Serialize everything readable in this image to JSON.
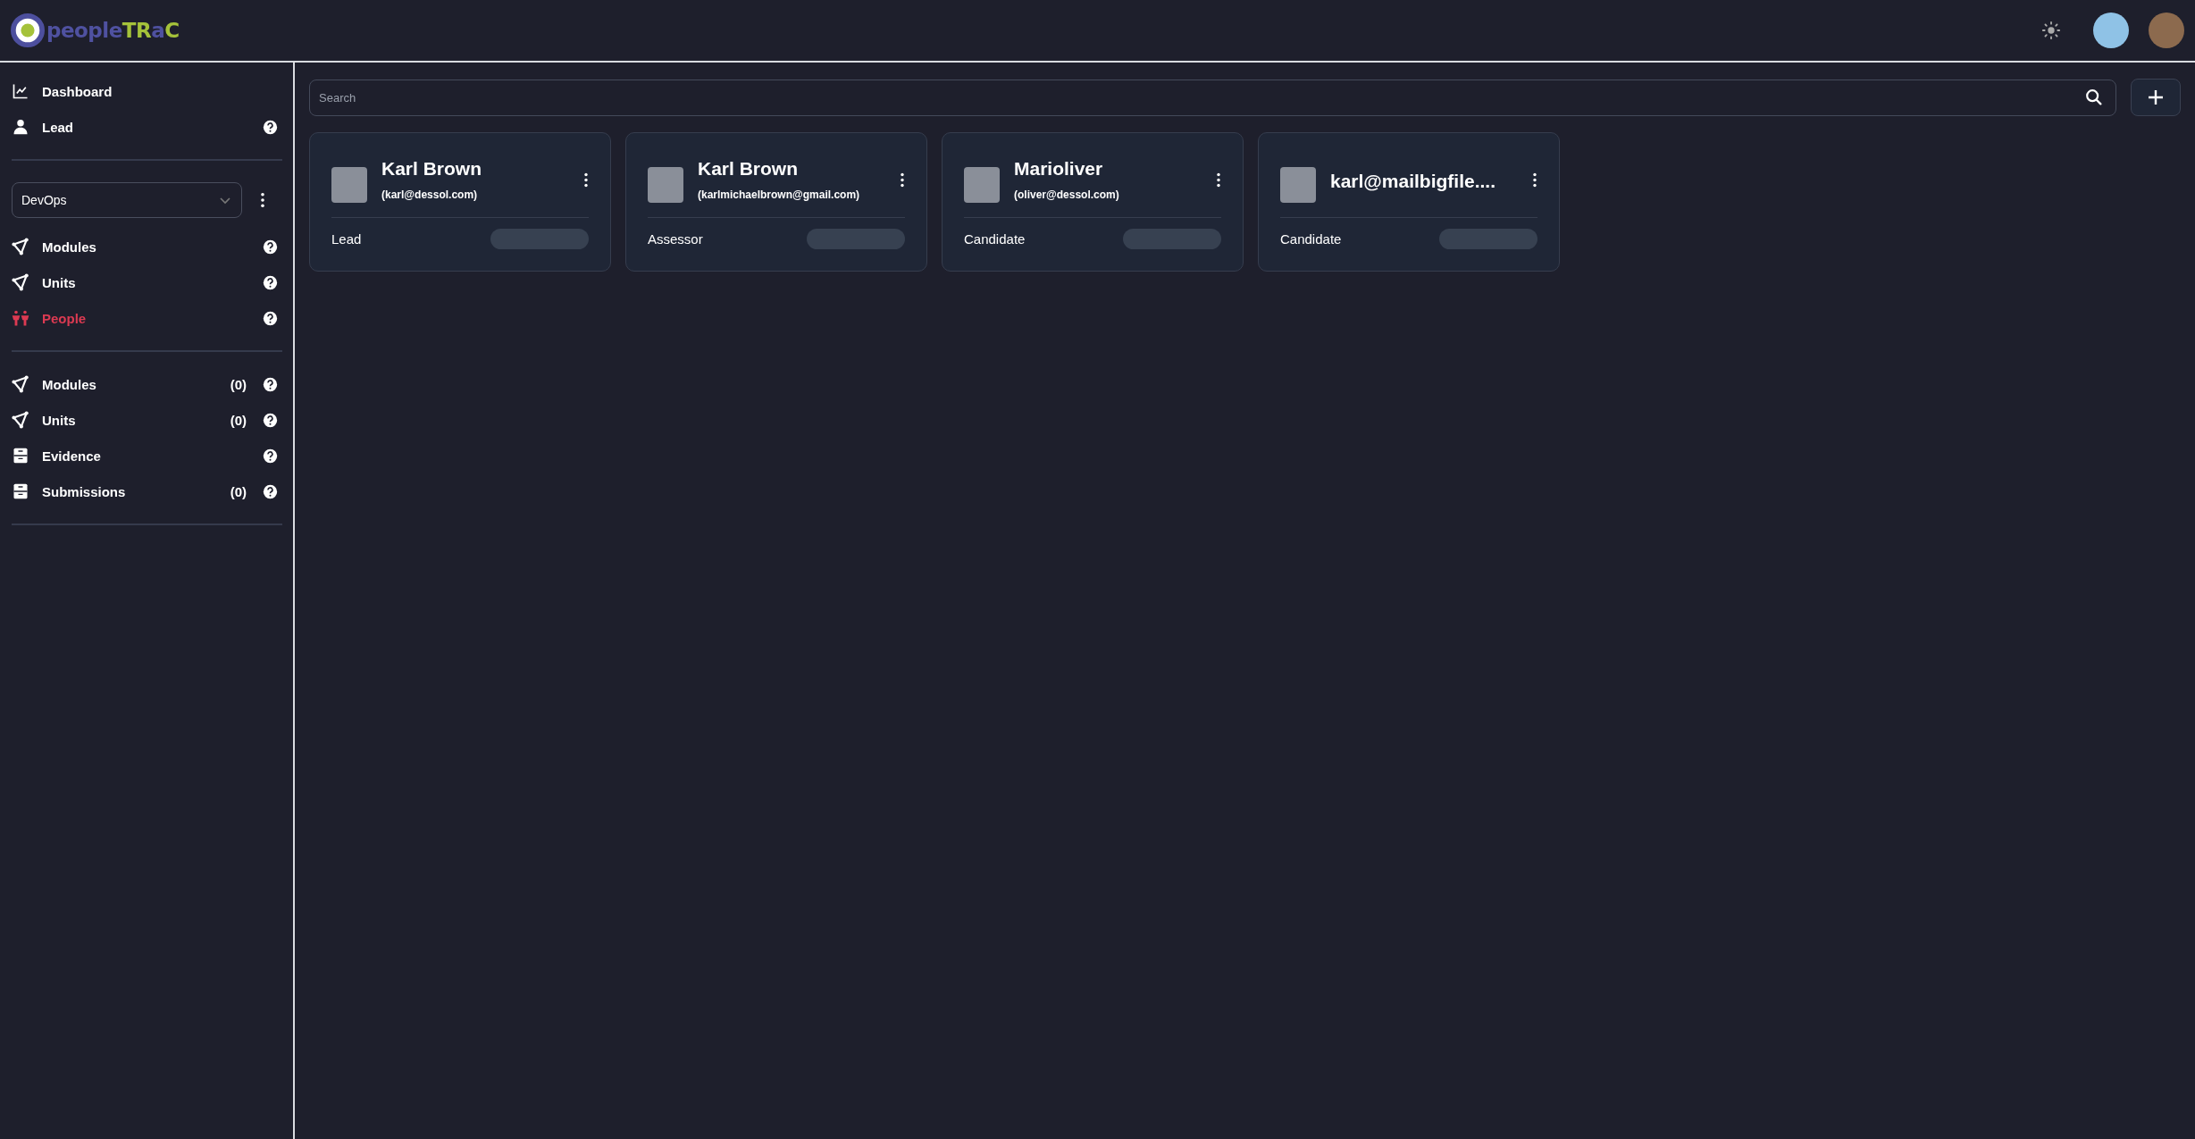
{
  "header": {
    "logo": [
      {
        "text": "people",
        "kind": "primary"
      },
      {
        "text": "TR",
        "kind": "accent"
      },
      {
        "text": "a",
        "kind": "primary"
      },
      {
        "text": "C",
        "kind": "accent"
      }
    ]
  },
  "sidebar": {
    "top_items": [
      {
        "label": "Dashboard",
        "help": false,
        "selected": false
      },
      {
        "label": "Lead",
        "help": true,
        "selected": false
      }
    ],
    "workspace_select": {
      "value": "DevOps"
    },
    "workspace_items": [
      {
        "label": "Modules",
        "help": true,
        "selected": false
      },
      {
        "label": "Units",
        "help": true,
        "selected": false
      },
      {
        "label": "People",
        "help": true,
        "selected": true
      }
    ],
    "content_items": [
      {
        "label": "Modules",
        "count": "(0)",
        "help": true,
        "selected": false
      },
      {
        "label": "Units",
        "count": "(0)",
        "help": true,
        "selected": false
      },
      {
        "label": "Evidence",
        "help": true,
        "selected": false
      },
      {
        "label": "Submissions",
        "count": "(0)",
        "help": true,
        "selected": false
      }
    ]
  },
  "search": {
    "placeholder": "Search"
  },
  "people": [
    {
      "name": "Karl Brown",
      "email": "(karl@dessol.com)",
      "role": "Lead"
    },
    {
      "name": "Karl Brown",
      "email": "(karlmichaelbrown@gmail.com)",
      "role": "Assessor"
    },
    {
      "name": "Marioliver",
      "email": "(oliver@dessol.com)",
      "role": "Candidate"
    },
    {
      "name": "karl@mailbigfile....",
      "role": "Candidate"
    }
  ]
}
